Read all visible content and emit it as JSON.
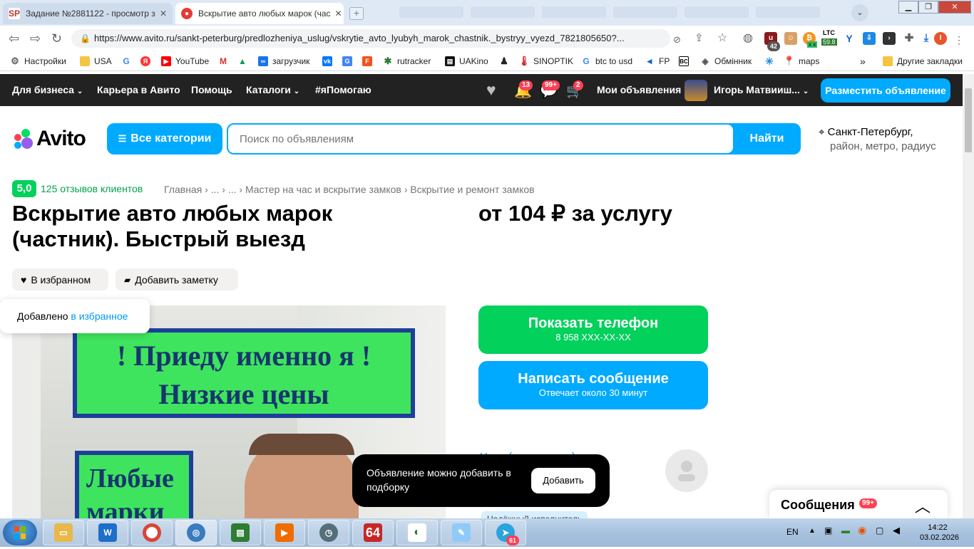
{
  "browser": {
    "tabs": [
      {
        "icon": "SP",
        "title": "Задание №2881122 - просмотр з"
      },
      {
        "title": "Вскрытие авто любых марок (час"
      }
    ],
    "url": "https://www.avito.ru/sankt-peterburg/predlozheniya_uslug/vskrytie_avto_lyubyh_marok_chastnik._bystryy_vyezd_7821805650?...",
    "extensions": {
      "badge_42": "42",
      "ltc_label": "LTC",
      "ltc_value": "59.8",
      "xx": "x x"
    },
    "bookmarks": [
      "Настройки",
      "USA",
      "YouTube",
      "загрузчик",
      "rutracker",
      "UAKino",
      "SINOPTIK",
      "btc to usd",
      "FP",
      "Обмінник",
      "maps"
    ],
    "bookmarks_more": "»",
    "other_bookmarks": "Другие закладки"
  },
  "topbar": {
    "nav": [
      "Для бизнеса",
      "Карьера в Авито",
      "Помощь",
      "Каталоги",
      "#яПомогаю"
    ],
    "notifications_badge": "13",
    "messages_badge": "99+",
    "cart_badge": "2",
    "my_ads": "Мои объявления",
    "user_name": "Игорь Матвииш...",
    "post_ad": "Разместить объявление"
  },
  "header": {
    "logo": "Avito",
    "categories_button": "Все категории",
    "search_placeholder": "Поиск по объявлениям",
    "search_button": "Найти",
    "city": "Санкт-Петербург,",
    "city_sub": "район, метро, радиус"
  },
  "listing": {
    "rating": "5,0",
    "reviews": "125 отзывов клиентов",
    "breadcrumb": "Главная › ... › ... › Мастер на час и вскрытие замков › Вскрытие и ремонт замков",
    "title": "Вскрытие авто любых марок (частник). Быстрый выезд",
    "price": "от 104 ₽ за услугу",
    "favorite": "В избранном",
    "add_note": "Добавить заметку",
    "added_tip_prefix": "Добавлено ",
    "added_tip_link": "в избранное",
    "photo_sign_top_1": "! Приеду именно я !",
    "photo_sign_top_2": "Низкие цены",
    "photo_sign_left_1": "Любые",
    "photo_sign_left_2": "марки"
  },
  "contact": {
    "show_phone": "Показать телефон",
    "phone_masked": "8 958 XXX-XX-XX",
    "write_message": "Написать сообщение",
    "response_time": "Отвечает около 30 минут",
    "seller_name": "Н...... (......... ....кам)",
    "reliable": "Надёжный исполнитель"
  },
  "toast": {
    "text": "Объявление можно добавить в подборку",
    "button": "Добавить"
  },
  "messages_panel": {
    "title": "Сообщения",
    "badge": "99+"
  },
  "taskbar": {
    "lang": "EN",
    "time": "14:22",
    "date": "03.02.2026",
    "telegram_badge": "61",
    "app64": "64"
  },
  "colors": {
    "avito_blue": "#00aaff",
    "avito_green": "#02d15c",
    "badge_red": "#ff4053"
  }
}
